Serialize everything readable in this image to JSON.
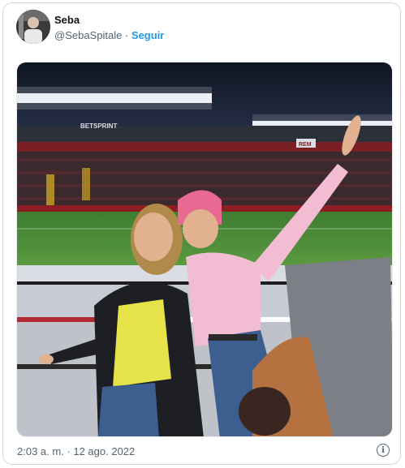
{
  "tweet": {
    "author_name": "Seba",
    "author_handle": "@SebaSpitale",
    "separator": "·",
    "follow_label": "Seguir",
    "timestamp": "2:03 a. m. · 12 ago. 2022",
    "info_icon": "info-icon"
  },
  "photo": {
    "sign_left": "BETSPRINT",
    "sign_right": "REM"
  },
  "colors": {
    "accent": "#1d9bf0",
    "muted": "#536471"
  }
}
